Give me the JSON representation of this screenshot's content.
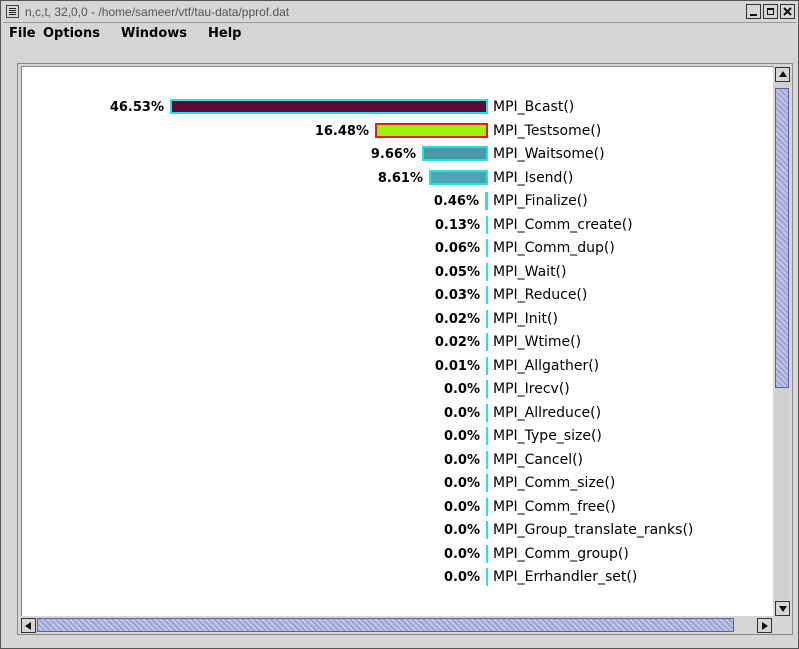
{
  "window": {
    "title": "n,c,t, 32,0,0 - /home/sameer/vtf/tau-data/pprof.dat"
  },
  "menu": [
    "File",
    "Options",
    "Windows",
    "Help"
  ],
  "colors": {
    "mpi_bcast": "#5a0a33",
    "mpi_testsome": "#9ef10a",
    "mpi_testsome_border": "#e0201b",
    "mpi_waitsome": "#4a9aa5",
    "mpi_isend": "#4ea3b0",
    "bar_outline": "#26e0e8"
  },
  "chart_data": {
    "type": "bar",
    "orientation": "horizontal",
    "categories": [
      "MPI_Bcast()",
      "MPI_Testsome()",
      "MPI_Waitsome()",
      "MPI_Isend()",
      "MPI_Finalize()",
      "MPI_Comm_create()",
      "MPI_Comm_dup()",
      "MPI_Wait()",
      "MPI_Reduce()",
      "MPI_Init()",
      "MPI_Wtime()",
      "MPI_Allgather()",
      "MPI_Irecv()",
      "MPI_Allreduce()",
      "MPI_Type_size()",
      "MPI_Cancel()",
      "MPI_Comm_size()",
      "MPI_Comm_free()",
      "MPI_Group_translate_ranks()",
      "MPI_Comm_group()",
      "MPI_Errhandler_set()"
    ],
    "labels": [
      "46.53%",
      "16.48%",
      "9.66%",
      "8.61%",
      "0.46%",
      "0.13%",
      "0.06%",
      "0.05%",
      "0.03%",
      "0.02%",
      "0.02%",
      "0.01%",
      "0.0%",
      "0.0%",
      "0.0%",
      "0.0%",
      "0.0%",
      "0.0%",
      "0.0%",
      "0.0%",
      "0.0%"
    ],
    "values": [
      46.53,
      16.48,
      9.66,
      8.61,
      0.46,
      0.13,
      0.06,
      0.05,
      0.03,
      0.02,
      0.02,
      0.01,
      0.0,
      0.0,
      0.0,
      0.0,
      0.0,
      0.0,
      0.0,
      0.0,
      0.0
    ],
    "xlim": [
      0,
      46.53
    ]
  }
}
